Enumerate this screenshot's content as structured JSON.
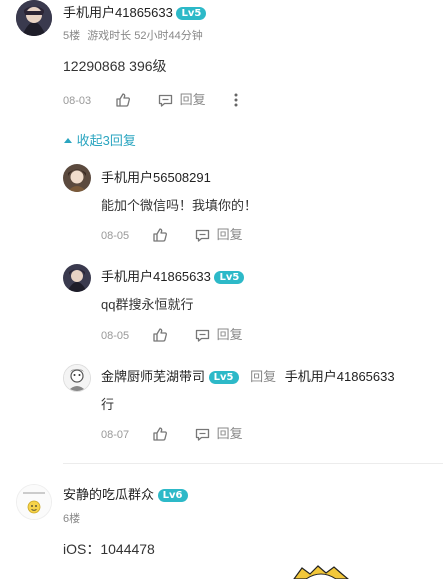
{
  "posts": [
    {
      "username": "手机用户41865633",
      "level": "Lv5",
      "floor": "5楼",
      "playtime": "游戏时长 52小时44分钟",
      "content": "12290868 396级",
      "date": "08-03",
      "reply_label": "回复"
    },
    {
      "username": "安静的吃瓜群众",
      "level": "Lv6",
      "floor": "6楼",
      "content": "iOS：1044478"
    }
  ],
  "collapse_label": "收起3回复",
  "replies": [
    {
      "username": "手机用户56508291",
      "content": "能加个微信吗！我填你的！",
      "date": "08-05",
      "reply_label": "回复"
    },
    {
      "username": "手机用户41865633",
      "level": "Lv5",
      "content": "qq群搜永恒就行",
      "date": "08-05",
      "reply_label": "回复"
    },
    {
      "username": "金牌厨师芜湖带司",
      "level": "Lv5",
      "reply_word": "回复",
      "reply_to": "手机用户41865633",
      "content": "行",
      "date": "08-07",
      "reply_label": "回复"
    }
  ],
  "icons": {
    "like": "thumbs-up-icon",
    "comment": "comment-icon",
    "more": "more-dots-icon",
    "collapse": "caret-up-icon"
  },
  "colors": {
    "accent": "#2aa5c0",
    "level_badge": "#2db9c8"
  }
}
